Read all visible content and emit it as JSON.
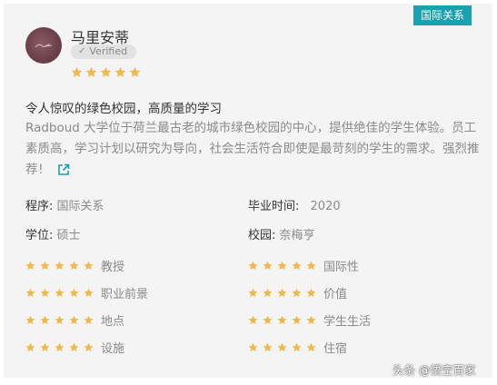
{
  "tag": "国际关系",
  "reviewer": {
    "name": "马里安蒂",
    "verified_label": "Verified",
    "overall_stars": 5
  },
  "review": {
    "title": "令人惊叹的绿色校园，高质量的学习",
    "body": "Radboud 大学位于荷兰最古老的城市绿色校园的中心，提供绝佳的学生体验。员工素质高，学习计划以研究为导向，社会生活符合即使是最苛刻的学生的需求。强烈推荐！"
  },
  "fields": {
    "program_label": "程序:",
    "program_value": "国际关系",
    "graduation_label": "毕业时间:",
    "graduation_value": "2020",
    "degree_label": "学位:",
    "degree_value": "硕士",
    "campus_label": "校园:",
    "campus_value": "奈梅亨"
  },
  "ratings": {
    "left": [
      {
        "label": "教授",
        "stars": 5
      },
      {
        "label": "职业前景",
        "stars": 5
      },
      {
        "label": "地点",
        "stars": 5
      },
      {
        "label": "设施",
        "stars": 5
      }
    ],
    "right": [
      {
        "label": "国际性",
        "stars": 5
      },
      {
        "label": "价值",
        "stars": 5
      },
      {
        "label": "学生生活",
        "stars": 5
      },
      {
        "label": "住宿",
        "stars": 5
      }
    ]
  },
  "watermark": "头条 @悟空百家",
  "colors": {
    "star": "#f1b84a",
    "tag_bg": "#1aa0ae",
    "link": "#1aa0ae"
  },
  "icons": {
    "verified": "check-icon",
    "external": "external-link-icon"
  }
}
